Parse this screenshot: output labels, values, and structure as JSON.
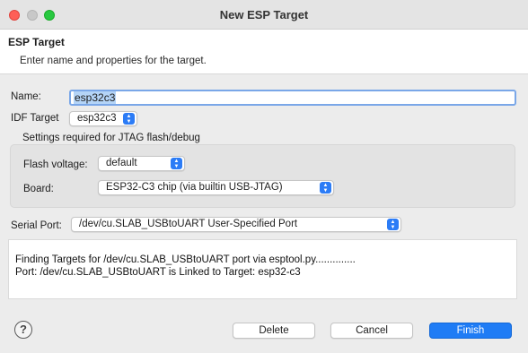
{
  "window": {
    "title": "New ESP Target"
  },
  "banner": {
    "title": "ESP Target",
    "description": "Enter name and properties for the target."
  },
  "form": {
    "name_label": "Name:",
    "name_value": "esp32c3",
    "idf_target_label": "IDF Target",
    "idf_target_value": "esp32c3",
    "jtag_group_label": "Settings required for JTAG flash/debug",
    "flash_voltage_label": "Flash voltage:",
    "flash_voltage_value": "default",
    "board_label": "Board:",
    "board_value": "ESP32-C3 chip (via builtin USB-JTAG)",
    "serial_port_label": "Serial Port:",
    "serial_port_value": "/dev/cu.SLAB_USBtoUART User-Specified Port"
  },
  "console": {
    "lines": [
      "Finding Targets for /dev/cu.SLAB_USBtoUART port via esptool.py..............",
      "Port: /dev/cu.SLAB_USBtoUART is Linked to Target: esp32-c3"
    ]
  },
  "footer": {
    "help_symbol": "?",
    "delete_label": "Delete",
    "cancel_label": "Cancel",
    "finish_label": "Finish"
  },
  "colors": {
    "accent": "#1f7cf5",
    "close": "#fe5f57",
    "zoom": "#28c840"
  }
}
